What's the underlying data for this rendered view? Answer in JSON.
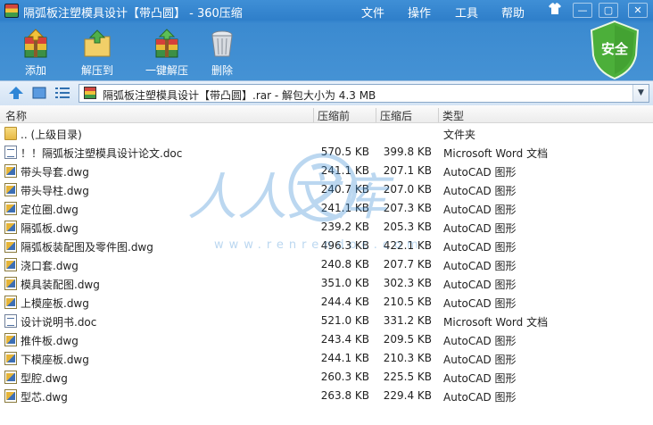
{
  "window": {
    "title": "隔弧板注塑模具设计【带凸圆】 - 360压缩",
    "menu": [
      "文件",
      "操作",
      "工具",
      "帮助"
    ],
    "controls": [
      "minimize",
      "maximize",
      "close"
    ]
  },
  "toolbar": {
    "buttons": [
      {
        "label": "添加",
        "icon": "add-archive-icon"
      },
      {
        "label": "解压到",
        "icon": "extract-to-folder-icon"
      },
      {
        "label": "一键解压",
        "icon": "one-click-extract-icon"
      },
      {
        "label": "删除",
        "icon": "delete-trash-icon"
      }
    ],
    "security_badge": "安全"
  },
  "addressbar": {
    "path": "隔弧板注塑模具设计【带凸圆】.rar - 解包大小为 4.3 MB"
  },
  "columns": {
    "name": "名称",
    "packed": "压缩前",
    "size": "压缩后",
    "type": "类型"
  },
  "files": [
    {
      "name": ".. (上级目录)",
      "packed": "",
      "size": "",
      "type": "文件夹",
      "icon": "folder-icon"
    },
    {
      "name": "！！隔弧板注塑模具设计论文.doc",
      "packed": "570.5 KB",
      "size": "399.8 KB",
      "type": "Microsoft Word 文档",
      "icon": "word-doc-icon"
    },
    {
      "name": "带头导套.dwg",
      "packed": "241.1 KB",
      "size": "207.1 KB",
      "type": "AutoCAD 图形",
      "icon": "dwg-file-icon"
    },
    {
      "name": "带头导柱.dwg",
      "packed": "240.7 KB",
      "size": "207.0 KB",
      "type": "AutoCAD 图形",
      "icon": "dwg-file-icon"
    },
    {
      "name": "定位圈.dwg",
      "packed": "241.1 KB",
      "size": "207.3 KB",
      "type": "AutoCAD 图形",
      "icon": "dwg-file-icon"
    },
    {
      "name": "隔弧板.dwg",
      "packed": "239.2 KB",
      "size": "205.3 KB",
      "type": "AutoCAD 图形",
      "icon": "dwg-file-icon"
    },
    {
      "name": "隔弧板装配图及零件图.dwg",
      "packed": "496.3 KB",
      "size": "422.1 KB",
      "type": "AutoCAD 图形",
      "icon": "dwg-file-icon"
    },
    {
      "name": "浇口套.dwg",
      "packed": "240.8 KB",
      "size": "207.7 KB",
      "type": "AutoCAD 图形",
      "icon": "dwg-file-icon"
    },
    {
      "name": "模具装配图.dwg",
      "packed": "351.0 KB",
      "size": "302.3 KB",
      "type": "AutoCAD 图形",
      "icon": "dwg-file-icon"
    },
    {
      "name": "上模座板.dwg",
      "packed": "244.4 KB",
      "size": "210.5 KB",
      "type": "AutoCAD 图形",
      "icon": "dwg-file-icon"
    },
    {
      "name": "设计说明书.doc",
      "packed": "521.0 KB",
      "size": "331.2 KB",
      "type": "Microsoft Word 文档",
      "icon": "word-doc-icon"
    },
    {
      "name": "推件板.dwg",
      "packed": "243.4 KB",
      "size": "209.5 KB",
      "type": "AutoCAD 图形",
      "icon": "dwg-file-icon"
    },
    {
      "name": "下模座板.dwg",
      "packed": "244.1 KB",
      "size": "210.3 KB",
      "type": "AutoCAD 图形",
      "icon": "dwg-file-icon"
    },
    {
      "name": "型腔.dwg",
      "packed": "260.3 KB",
      "size": "225.5 KB",
      "type": "AutoCAD 图形",
      "icon": "dwg-file-icon"
    },
    {
      "name": "型芯.dwg",
      "packed": "263.8 KB",
      "size": "229.4 KB",
      "type": "AutoCAD 图形",
      "icon": "dwg-file-icon"
    }
  ],
  "watermark": {
    "text": "人人文库",
    "url": "www.renrendoc.com"
  },
  "colors": {
    "titlebar": "#2f7fca",
    "toolbar": "#4592d4",
    "security_badge": "#4caf3a",
    "watermark": "#3e8fd6"
  }
}
